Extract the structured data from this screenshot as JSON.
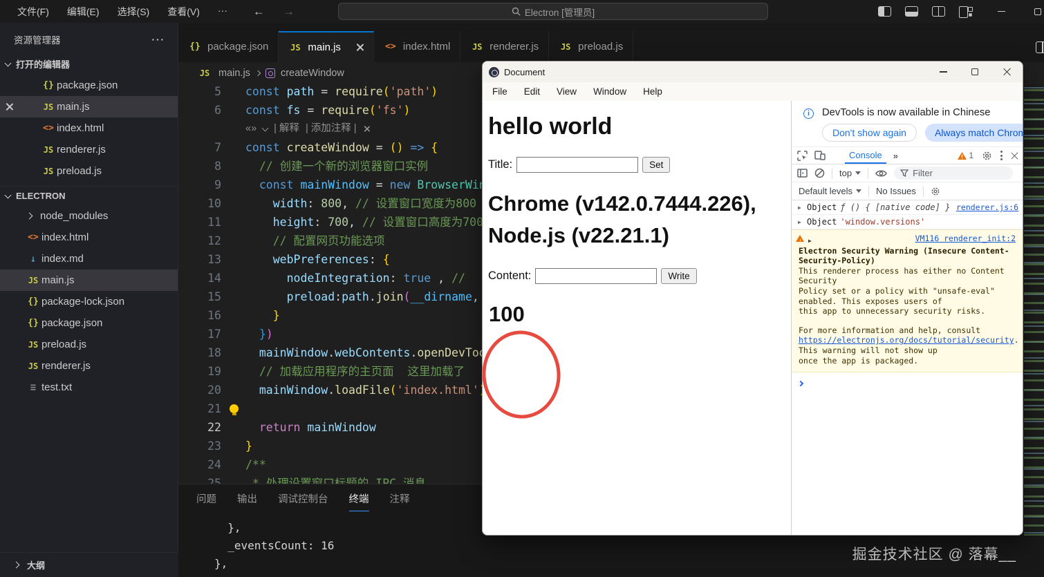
{
  "colors": {
    "accent_blue": "#0078d4",
    "devtools_blue": "#1a73e8",
    "warning_bg": "#fffbe5",
    "annotation_red": "#e74a3f",
    "editor_bg": "#1f1f1f"
  },
  "icon_glyphs": {
    "js": "JS",
    "json": "{}",
    "html": "<>",
    "md": "↓",
    "txt": "≡"
  },
  "vscode": {
    "titlebar": {
      "menus": [
        "文件(F)",
        "编辑(E)",
        "选择(S)",
        "查看(V)",
        "···"
      ],
      "back_arrow": "←",
      "forward_arrow": "→",
      "search": "Electron [管理员]"
    },
    "sidebar": {
      "title": "资源管理器",
      "title_menu": "···",
      "open_editors": {
        "label": "打开的编辑器",
        "items": [
          {
            "icon": "json",
            "label": "package.json"
          },
          {
            "icon": "js",
            "label": "main.js",
            "close": true,
            "active": true
          },
          {
            "icon": "html",
            "label": "index.html"
          },
          {
            "icon": "js",
            "label": "renderer.js"
          },
          {
            "icon": "js",
            "label": "preload.js"
          }
        ]
      },
      "tree": {
        "label": "ELECTRON",
        "items": [
          {
            "chevron": true,
            "label": "node_modules"
          },
          {
            "icon": "html",
            "label": "index.html"
          },
          {
            "icon": "md",
            "label": "index.md"
          },
          {
            "icon": "js",
            "label": "main.js",
            "selected": true
          },
          {
            "icon": "json",
            "label": "package-lock.json"
          },
          {
            "icon": "json",
            "label": "package.json"
          },
          {
            "icon": "js",
            "label": "preload.js"
          },
          {
            "icon": "js",
            "label": "renderer.js"
          },
          {
            "icon": "txt",
            "label": "test.txt"
          }
        ]
      },
      "outline_label": "大纲"
    },
    "tabs": [
      {
        "icon": "json",
        "label": "package.json"
      },
      {
        "icon": "js",
        "label": "main.js",
        "active": true
      },
      {
        "icon": "html",
        "label": "index.html"
      },
      {
        "icon": "js",
        "label": "renderer.js"
      },
      {
        "icon": "js",
        "label": "preload.js"
      }
    ],
    "breadcrumb": {
      "file_icon": "js",
      "file": "main.js",
      "symbol": "createWindow"
    },
    "editor": {
      "inline_chat": {
        "logo": "«»",
        "explain": "| 解释",
        "add_comment": "| 添加注释 |"
      },
      "lines": [
        {
          "n": "5",
          "segs": [
            [
              "const ",
              "kw"
            ],
            [
              "path",
              "var"
            ],
            [
              " = ",
              "op"
            ],
            [
              "require",
              "fn"
            ],
            [
              "(",
              "by"
            ],
            [
              "'path'",
              "str"
            ],
            [
              ")",
              "by"
            ]
          ]
        },
        {
          "n": "6",
          "segs": [
            [
              "const ",
              "kw"
            ],
            [
              "fs",
              "var"
            ],
            [
              " = ",
              "op"
            ],
            [
              "require",
              "fn"
            ],
            [
              "(",
              "by"
            ],
            [
              "'fs'",
              "str"
            ],
            [
              ")",
              "by"
            ]
          ]
        },
        {
          "widget": true
        },
        {
          "n": "7",
          "segs": [
            [
              "const ",
              "kw"
            ],
            [
              "createWindow",
              "fn"
            ],
            [
              " = ",
              "op"
            ],
            [
              "()",
              "by"
            ],
            [
              " => ",
              "kw"
            ],
            [
              "{",
              "by"
            ]
          ]
        },
        {
          "n": "8",
          "segs": [
            [
              "  ",
              "op"
            ],
            [
              "// 创建一个新的浏览器窗口实例",
              "cmt"
            ]
          ]
        },
        {
          "n": "9",
          "segs": [
            [
              "  const ",
              "kw"
            ],
            [
              "mainWindow",
              "var2"
            ],
            [
              " = ",
              "op"
            ],
            [
              "new ",
              "kw"
            ],
            [
              "BrowserWindow",
              "cls"
            ],
            [
              "({",
              "bp"
            ]
          ]
        },
        {
          "n": "10",
          "segs": [
            [
              "    ",
              "op"
            ],
            [
              "width",
              "var"
            ],
            [
              ": ",
              "op"
            ],
            [
              "800",
              "num"
            ],
            [
              ", ",
              "op"
            ],
            [
              "// 设置窗口宽度为800",
              "cmt"
            ]
          ]
        },
        {
          "n": "11",
          "segs": [
            [
              "    ",
              "op"
            ],
            [
              "height",
              "var"
            ],
            [
              ": ",
              "op"
            ],
            [
              "700",
              "num"
            ],
            [
              ", ",
              "op"
            ],
            [
              "// 设置窗口高度为700",
              "cmt"
            ]
          ]
        },
        {
          "n": "12",
          "segs": [
            [
              "    ",
              "op"
            ],
            [
              "// 配置网页功能选项",
              "cmt"
            ]
          ]
        },
        {
          "n": "13",
          "segs": [
            [
              "    ",
              "op"
            ],
            [
              "webPreferences",
              "var"
            ],
            [
              ": ",
              "op"
            ],
            [
              "{",
              "by"
            ]
          ]
        },
        {
          "n": "14",
          "segs": [
            [
              "      ",
              "op"
            ],
            [
              "nodeIntegration",
              "var"
            ],
            [
              ": ",
              "op"
            ],
            [
              "true",
              "kw"
            ],
            [
              " , ",
              "op"
            ],
            [
              "//",
              "cmt"
            ]
          ]
        },
        {
          "n": "15",
          "segs": [
            [
              "      ",
              "op"
            ],
            [
              "preload",
              "var"
            ],
            [
              ":",
              "op"
            ],
            [
              "path",
              "var"
            ],
            [
              ".",
              "op"
            ],
            [
              "join",
              "fn"
            ],
            [
              "(",
              "bp"
            ],
            [
              "__dirname",
              "var2"
            ],
            [
              ",",
              "op"
            ]
          ]
        },
        {
          "n": "16",
          "segs": [
            [
              "    ",
              "op"
            ],
            [
              "}",
              "by"
            ]
          ]
        },
        {
          "n": "17",
          "segs": [
            [
              "  ",
              "op"
            ],
            [
              "}",
              "bb"
            ],
            [
              ")",
              "bp"
            ]
          ]
        },
        {
          "n": "18",
          "segs": [
            [
              "  ",
              "op"
            ],
            [
              "mainWindow",
              "var"
            ],
            [
              ".",
              "op"
            ],
            [
              "webContents",
              "var"
            ],
            [
              ".",
              "op"
            ],
            [
              "openDevTools",
              "fn"
            ],
            [
              "()",
              "by"
            ]
          ]
        },
        {
          "n": "19",
          "segs": [
            [
              "  ",
              "op"
            ],
            [
              "// 加载应用程序的主页面  这里加载了",
              "cmt"
            ]
          ]
        },
        {
          "n": "20",
          "segs": [
            [
              "  ",
              "op"
            ],
            [
              "mainWindow",
              "var"
            ],
            [
              ".",
              "op"
            ],
            [
              "loadFile",
              "fn"
            ],
            [
              "(",
              "by"
            ],
            [
              "'index.html'",
              "str"
            ],
            [
              ")",
              "by"
            ]
          ]
        },
        {
          "n": "21",
          "bulb": true,
          "segs": []
        },
        {
          "n": "22",
          "current": true,
          "segs": [
            [
              "  ",
              "op"
            ],
            [
              "return ",
              "ret"
            ],
            [
              "mainWindow",
              "var"
            ]
          ]
        },
        {
          "n": "23",
          "segs": [
            [
              "}",
              "by"
            ]
          ]
        },
        {
          "n": "24",
          "segs": [
            [
              "/**",
              "cmt"
            ]
          ]
        },
        {
          "n": "25",
          "segs": [
            [
              " * 处理设置窗口标题的 IPC 消息",
              "cmt"
            ]
          ]
        }
      ]
    },
    "panel": {
      "tabs": [
        "问题",
        "输出",
        "调试控制台",
        "终端",
        "注释"
      ],
      "active": "终端",
      "terminal_lines": [
        "  },",
        "  _eventsCount: 16",
        "},"
      ]
    },
    "watermark": "掘金技术社区 @ 落幕__"
  },
  "app": {
    "window_title": "Document",
    "menus": [
      "File",
      "Edit",
      "View",
      "Window",
      "Help"
    ],
    "heading": "hello world",
    "title_label": "Title:",
    "set_button": "Set",
    "versions": "Chrome (v142.0.7444.226), Node.js (v22.21.1)",
    "content_label": "Content:",
    "write_button": "Write",
    "value": "100"
  },
  "devtools": {
    "notice": {
      "text": "DevTools is now available in Chinese",
      "dismiss": "Don't show again",
      "accept": "Always match Chrome's l"
    },
    "tabbar": {
      "tab": "Console",
      "more": "»",
      "warn_count": "1"
    },
    "toolbar": {
      "context": "top",
      "filter": "Filter"
    },
    "statusbar": {
      "levels": "Default levels",
      "issues": "No Issues"
    },
    "console_rows": [
      {
        "label": "Object",
        "preview": "ƒ () { [native code] }",
        "ptype": "fn",
        "source": "renderer.js:6"
      },
      {
        "label": "Object",
        "preview": "'window.versions'",
        "ptype": "str"
      }
    ],
    "warning": {
      "source": "VM116 renderer_init:2",
      "title": "Electron Security Warning (Insecure Content-Security-Policy)",
      "body": [
        "This renderer process has either no Content",
        "Security",
        "  Policy set or a policy with \"unsafe-eval\"",
        "enabled. This exposes users of",
        "  this app to unnecessary security risks.",
        "",
        "For more information and help, consult",
        "https://electronjs.org/docs/tutorial/security.",
        "This warning will not show up",
        "once the app is packaged."
      ]
    }
  }
}
